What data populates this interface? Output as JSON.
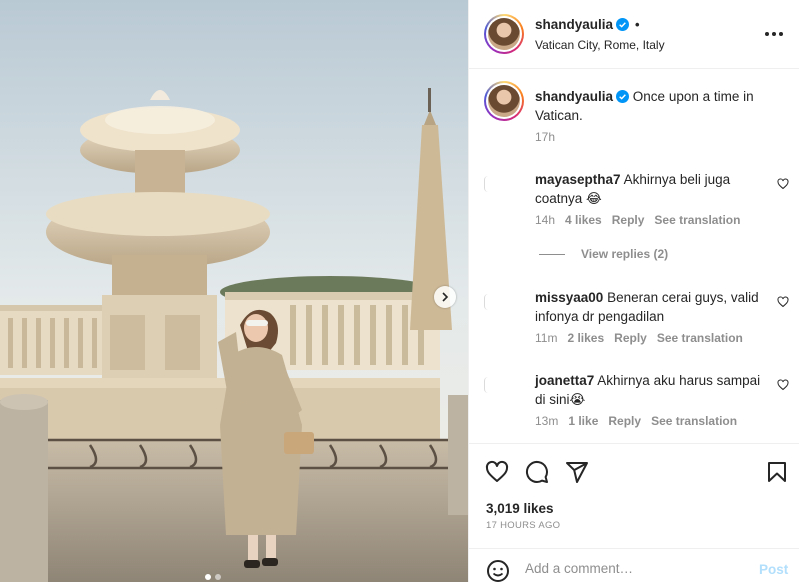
{
  "post": {
    "username": "shandyaulia",
    "separator": "•",
    "location": "Vatican City, Rome, Italy",
    "caption": "Once upon a time in Vatican.",
    "caption_time": "17h",
    "likes": "3,019 likes",
    "posted": "17 HOURS AGO",
    "slide_count": 2,
    "active_slide": 1
  },
  "comments": [
    {
      "user": "mayaseptha7",
      "text": "Akhirnya beli juga coatnya 😂",
      "time": "14h",
      "likes": "4 likes",
      "reply": "Reply",
      "translate": "See translation"
    },
    {
      "user": "missyaa00",
      "text": "Beneran cerai guys, valid infonya dr pengadilan",
      "time": "11m",
      "likes": "2 likes",
      "reply": "Reply",
      "translate": "See translation"
    },
    {
      "user": "joanetta7",
      "text": "Akhirnya aku harus sampai di sini😭",
      "time": "13m",
      "likes": "1 like",
      "reply": "Reply",
      "translate": "See translation"
    }
  ],
  "view_replies": "View replies (2)",
  "add_comment": {
    "placeholder": "Add a comment…",
    "post_label": "Post"
  },
  "colors": {
    "verified": "#0095f6",
    "post_disabled": "#b2dffc",
    "muted": "#8e8e8e"
  }
}
